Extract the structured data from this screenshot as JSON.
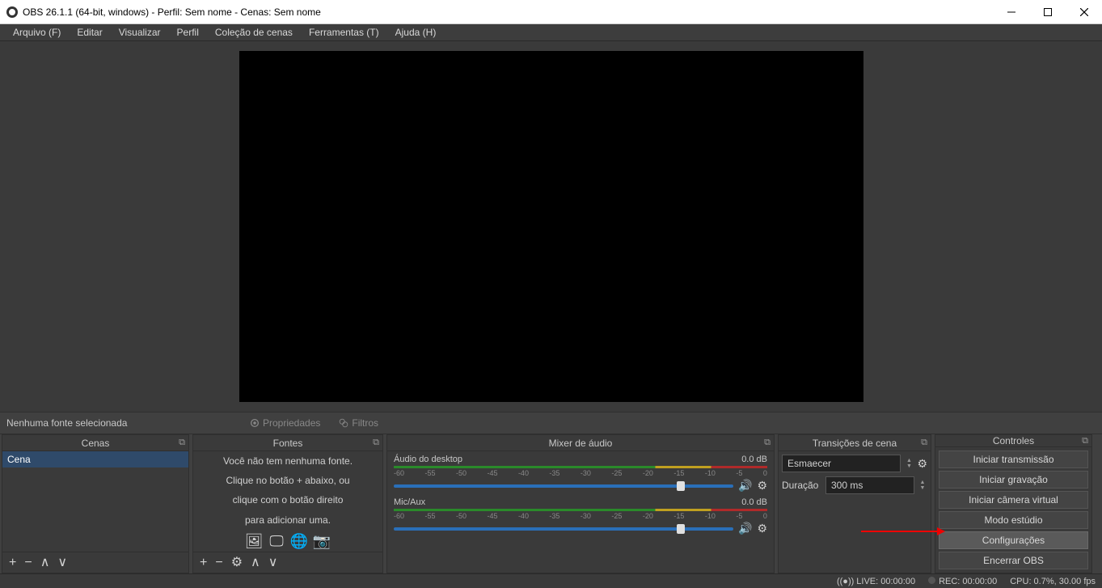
{
  "window": {
    "title": "OBS 26.1.1 (64-bit, windows) - Perfil: Sem nome - Cenas: Sem nome"
  },
  "menu": {
    "arquivo": "Arquivo (F)",
    "editar": "Editar",
    "visualizar": "Visualizar",
    "perfil": "Perfil",
    "colecao": "Coleção de cenas",
    "ferramentas": "Ferramentas (T)",
    "ajuda": "Ajuda (H)"
  },
  "info": {
    "selected": "Nenhuma fonte selecionada",
    "propriedades": "Propriedades",
    "filtros": "Filtros"
  },
  "panels": {
    "scenes_header": "Cenas",
    "sources_header": "Fontes",
    "mixer_header": "Mixer de áudio",
    "transitions_header": "Transições de cena",
    "controls_header": "Controles"
  },
  "scenes": {
    "items": [
      "Cena"
    ]
  },
  "sources": {
    "empty_line1": "Você não tem nenhuma fonte.",
    "empty_line2": "Clique no botão + abaixo, ou",
    "empty_line3": "clique com o botão direito",
    "empty_line4": "para adicionar uma."
  },
  "mixer": {
    "ch1_name": "Áudio do desktop",
    "ch1_db": "0.0 dB",
    "ch2_name": "Mic/Aux",
    "ch2_db": "0.0 dB",
    "ticks": [
      "-60",
      "-55",
      "-50",
      "-45",
      "-40",
      "-35",
      "-30",
      "-25",
      "-20",
      "-15",
      "-10",
      "-5",
      "0"
    ]
  },
  "transitions": {
    "selected": "Esmaecer",
    "duration_label": "Duração",
    "duration_value": "300 ms"
  },
  "controls": {
    "start_stream": "Iniciar transmissão",
    "start_record": "Iniciar gravação",
    "start_vcam": "Iniciar câmera virtual",
    "studio": "Modo estúdio",
    "settings": "Configurações",
    "exit": "Encerrar OBS"
  },
  "status": {
    "live": "LIVE: 00:00:00",
    "rec": "REC: 00:00:00",
    "cpu": "CPU: 0.7%, 30.00 fps"
  }
}
